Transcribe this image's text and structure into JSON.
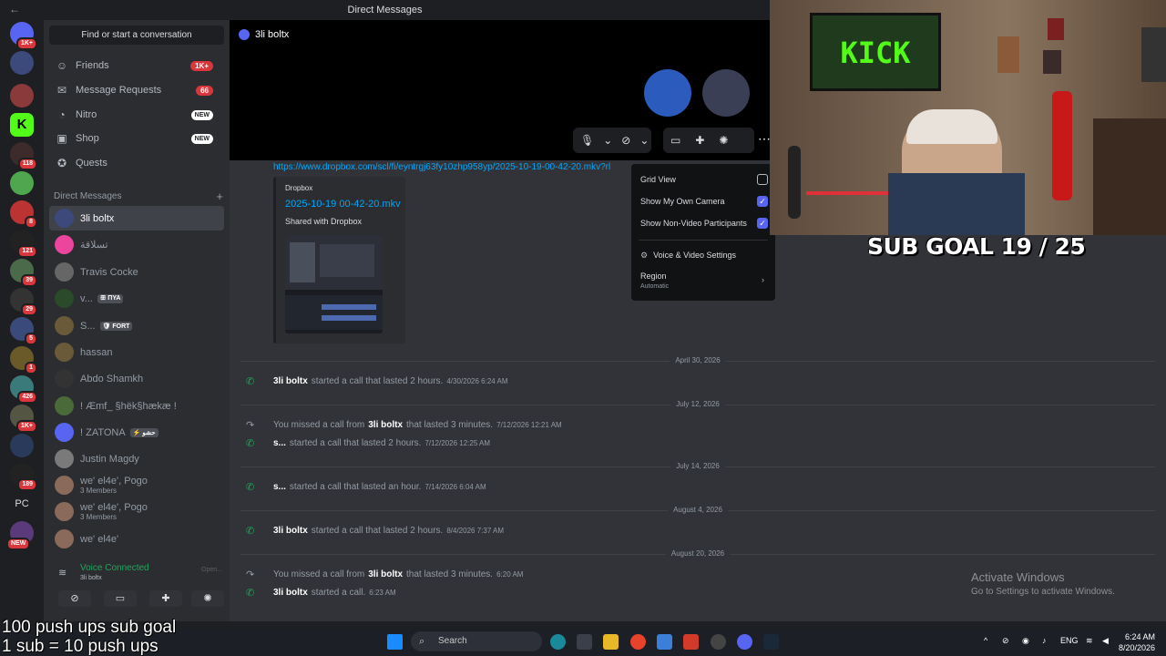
{
  "window": {
    "title": "Direct Messages",
    "back_icon": "arrow-left-icon"
  },
  "servers": [
    {
      "badge": "1K+"
    },
    {
      "badge": ""
    },
    {
      "badge": ""
    },
    {
      "badge": ""
    },
    {
      "badge": "118"
    },
    {
      "badge": ""
    },
    {
      "badge": "8"
    },
    {
      "badge": "121"
    },
    {
      "badge": "39"
    },
    {
      "badge": "29"
    },
    {
      "badge": "5"
    },
    {
      "badge": "1"
    },
    {
      "badge": "426"
    },
    {
      "badge": "1K+"
    },
    {
      "badge": ""
    },
    {
      "badge": "189"
    },
    {
      "badge": ""
    },
    {
      "badge": ""
    }
  ],
  "server_pc_label": "PC",
  "server_new_label": "NEW",
  "sidebar": {
    "find_placeholder": "Find or start a conversation",
    "nav": [
      {
        "label": "Friends",
        "badge": "1K+",
        "icon": "friends-icon"
      },
      {
        "label": "Message Requests",
        "badge": "66",
        "icon": "envelope-icon"
      },
      {
        "label": "Nitro",
        "new": "NEW",
        "icon": "nitro-icon"
      },
      {
        "label": "Shop",
        "new": "NEW",
        "icon": "shop-icon"
      },
      {
        "label": "Quests",
        "icon": "quests-icon"
      }
    ],
    "dm_header": "Direct Messages",
    "dms": [
      {
        "name": "3li boltx",
        "active": true
      },
      {
        "name": "تسلاقة"
      },
      {
        "name": "Travis Cocke"
      },
      {
        "name": "v...",
        "tag": "ꕥ ΠΥΑ"
      },
      {
        "name": "S...",
        "tag": "🛡 FORT"
      },
      {
        "name": "hassan"
      },
      {
        "name": "Abdo Shamkh"
      },
      {
        "name": "! Æmf_ §hëk§hækæ !"
      },
      {
        "name": "! ZATONA",
        "tag": "⚡ حشو"
      },
      {
        "name": "Justin Magdy"
      },
      {
        "name": "we' el4e', Pogo",
        "sub": "3 Members"
      },
      {
        "name": "we' el4e', Pogo",
        "sub": "3 Members"
      },
      {
        "name": "we' el4e'"
      }
    ],
    "voice": {
      "status": "Voice Connected",
      "channel": "3li boltx",
      "hint": "Open..."
    }
  },
  "main": {
    "channel_name": "3li boltx",
    "link": "https://www.dropbox.com/scl/fi/eyntrgj63fy10zhp958yp/2025-10-19-00-42-20.mkv?rl",
    "embed": {
      "provider": "Dropbox",
      "title": "2025-10-19 00-42-20.mkv",
      "desc": "Shared with Dropbox"
    },
    "dividers": [
      "April 30, 2026",
      "July 12, 2026",
      "July 14, 2026",
      "August 4, 2026",
      "August 20, 2026"
    ],
    "events": [
      {
        "kind": "started",
        "name": "3li boltx",
        "text": "started a call that lasted 2 hours.",
        "ts": "4/30/2026 6:24 AM"
      },
      {
        "kind": "missed",
        "pre": "You missed a call from",
        "name": "3li boltx",
        "text": "that lasted 3 minutes.",
        "ts": "7/12/2026 12:21 AM"
      },
      {
        "kind": "started",
        "name": "s...",
        "text": "started a call that lasted 2 hours.",
        "ts": "7/12/2026 12:25 AM"
      },
      {
        "kind": "started",
        "name": "s...",
        "text": "started a call that lasted an hour.",
        "ts": "7/14/2026 6:04 AM"
      },
      {
        "kind": "started",
        "name": "3li boltx",
        "text": "started a call that lasted 2 hours.",
        "ts": "8/4/2026 7:37 AM"
      },
      {
        "kind": "missed",
        "pre": "You missed a call from",
        "name": "3li boltx",
        "text": "that lasted 3 minutes.",
        "ts": "6:20 AM"
      },
      {
        "kind": "started",
        "name": "3li boltx",
        "text": "started a call.",
        "ts": "6:23 AM"
      }
    ]
  },
  "menu": {
    "items": [
      {
        "label": "Grid View",
        "checked": false
      },
      {
        "label": "Show My Own Camera",
        "checked": true
      },
      {
        "label": "Show Non-Video Participants",
        "checked": true
      }
    ],
    "settings_label": "Voice & Video Settings",
    "region_label": "Region",
    "region_value": "Automatic"
  },
  "stream": {
    "sub_goal": "SUB GOAL 19 / 25",
    "overlay_line1": "100 push ups sub goal",
    "overlay_line2": "1 sub  = 10 push ups",
    "kick_sign": "KICK"
  },
  "activate": {
    "title": "Activate Windows",
    "desc": "Go to Settings to activate Windows."
  },
  "taskbar": {
    "search_placeholder": "Search",
    "lang": "ENG",
    "time": "6:24 AM",
    "date": "8/20/2026"
  },
  "colors": {
    "accent": "#5865f2",
    "green": "#23a55a",
    "danger": "#da373c"
  }
}
